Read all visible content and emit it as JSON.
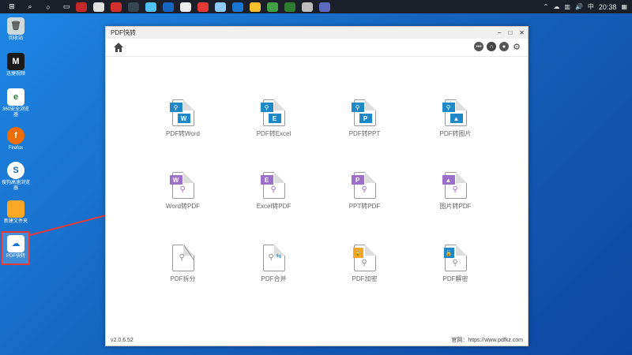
{
  "taskbar": {
    "icons": [
      "windows-start-icon",
      "search-icon",
      "cortana-icon",
      "task-view-icon",
      "app-icon",
      "app-icon",
      "app-icon",
      "app-icon",
      "app-icon",
      "app-icon",
      "app-icon",
      "app-icon",
      "app-icon",
      "app-icon",
      "app-icon",
      "app-icon",
      "app-icon",
      "app-icon"
    ],
    "tray": {
      "lang": "中",
      "time": "20:38"
    }
  },
  "desktop": {
    "icons": [
      {
        "label": "回收站",
        "color": "#d0d0d0",
        "glyph": "🗑"
      },
      {
        "label": "迅捷视频",
        "color": "#1a1a1a",
        "glyph": "M"
      },
      {
        "label": "360安全浏览器",
        "color": "#2e7d32",
        "glyph": "e"
      },
      {
        "label": "Firefox",
        "color": "#ef6c00",
        "glyph": "🦊"
      },
      {
        "label": "搜狗高速浏览器",
        "color": "#1565c0",
        "glyph": "S"
      },
      {
        "label": "新建文件夹",
        "color": "#f9a825",
        "glyph": ""
      },
      {
        "label": "PDF快转",
        "color": "#1976d2",
        "glyph": "☁"
      }
    ]
  },
  "window": {
    "title": "PDF快转",
    "controls": {
      "minimize": "–",
      "maximize": "□",
      "close": "✕"
    },
    "toolbar_icons": [
      "chat-icon",
      "headset-icon",
      "user-icon",
      "gear-icon"
    ],
    "status": {
      "version": "v2.0.6.52",
      "website": "官网：https://www.pdfkz.com"
    }
  },
  "tiles": [
    {
      "label": "PDF转Word",
      "badge": "W",
      "badgeColor": "#1e88c8",
      "style": "pdf-to"
    },
    {
      "label": "PDF转Excel",
      "badge": "E",
      "badgeColor": "#1e88c8",
      "style": "pdf-to"
    },
    {
      "label": "PDF转PPT",
      "badge": "P",
      "badgeColor": "#1e88c8",
      "style": "pdf-to"
    },
    {
      "label": "PDF转图片",
      "badge": "▲",
      "badgeColor": "#1e88c8",
      "style": "pdf-to"
    },
    {
      "label": "Word转PDF",
      "badge": "W",
      "badgeColor": "#9c6fc9",
      "style": "to-pdf"
    },
    {
      "label": "Excel转PDF",
      "badge": "E",
      "badgeColor": "#9c6fc9",
      "style": "to-pdf"
    },
    {
      "label": "PPT转PDF",
      "badge": "P",
      "badgeColor": "#9c6fc9",
      "style": "to-pdf"
    },
    {
      "label": "图片转PDF",
      "badge": "▲",
      "badgeColor": "#9c6fc9",
      "style": "to-pdf"
    },
    {
      "label": "PDF拆分",
      "badge": "",
      "badgeColor": "#aaaaaa",
      "style": "plain"
    },
    {
      "label": "PDF合并",
      "badge": "",
      "badgeColor": "#1e88c8",
      "style": "plain"
    },
    {
      "label": "PDF加密",
      "badge": "🔒",
      "badgeColor": "#f5a623",
      "style": "lock"
    },
    {
      "label": "PDF解密",
      "badge": "🔓",
      "badgeColor": "#1e88c8",
      "style": "lock"
    }
  ],
  "colors": {
    "accent_blue": "#1e88c8",
    "accent_purple": "#9c6fc9",
    "highlight_red": "#e53935"
  }
}
